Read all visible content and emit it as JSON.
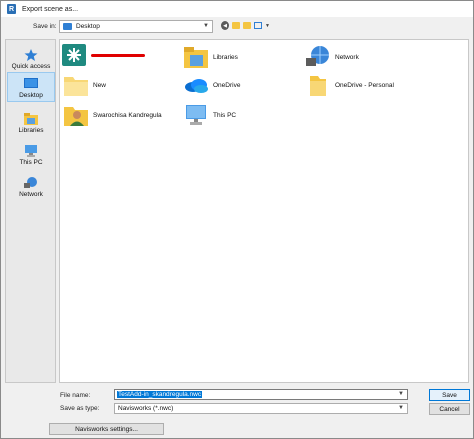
{
  "window": {
    "title": "Export scene as...",
    "app_badge": "R"
  },
  "toolbar": {
    "save_in_label": "Save in:",
    "save_in_value": "Desktop",
    "icons": [
      "back-icon",
      "up-folder-icon",
      "new-folder-icon",
      "view-menu-icon"
    ]
  },
  "places": [
    {
      "label": "Quick access",
      "icon": "star-icon"
    },
    {
      "label": "Desktop",
      "icon": "desktop-icon",
      "selected": true
    },
    {
      "label": "Libraries",
      "icon": "libraries-icon"
    },
    {
      "label": "This PC",
      "icon": "this-pc-icon"
    },
    {
      "label": "Network",
      "icon": "network-icon"
    }
  ],
  "files": [
    {
      "label": "",
      "icon": "app-shortcut-icon",
      "redacted": true
    },
    {
      "label": "Libraries",
      "icon": "libraries-icon"
    },
    {
      "label": "Network",
      "icon": "network-icon"
    },
    {
      "label": "New",
      "icon": "folder-icon"
    },
    {
      "label": "OneDrive",
      "icon": "onedrive-icon"
    },
    {
      "label": "OneDrive - Personal",
      "icon": "folder-icon"
    },
    {
      "label": "Swarochisa Kandregula",
      "icon": "user-folder-icon"
    },
    {
      "label": "This PC",
      "icon": "this-pc-icon"
    }
  ],
  "footer": {
    "file_name_label": "File name:",
    "file_name_value": "TestAdd-in_skandregula.nwc",
    "save_as_type_label": "Save as type:",
    "save_as_type_value": "Navisworks (*.nwc)",
    "save_label": "Save",
    "cancel_label": "Cancel",
    "settings_label": "Navisworks settings..."
  }
}
